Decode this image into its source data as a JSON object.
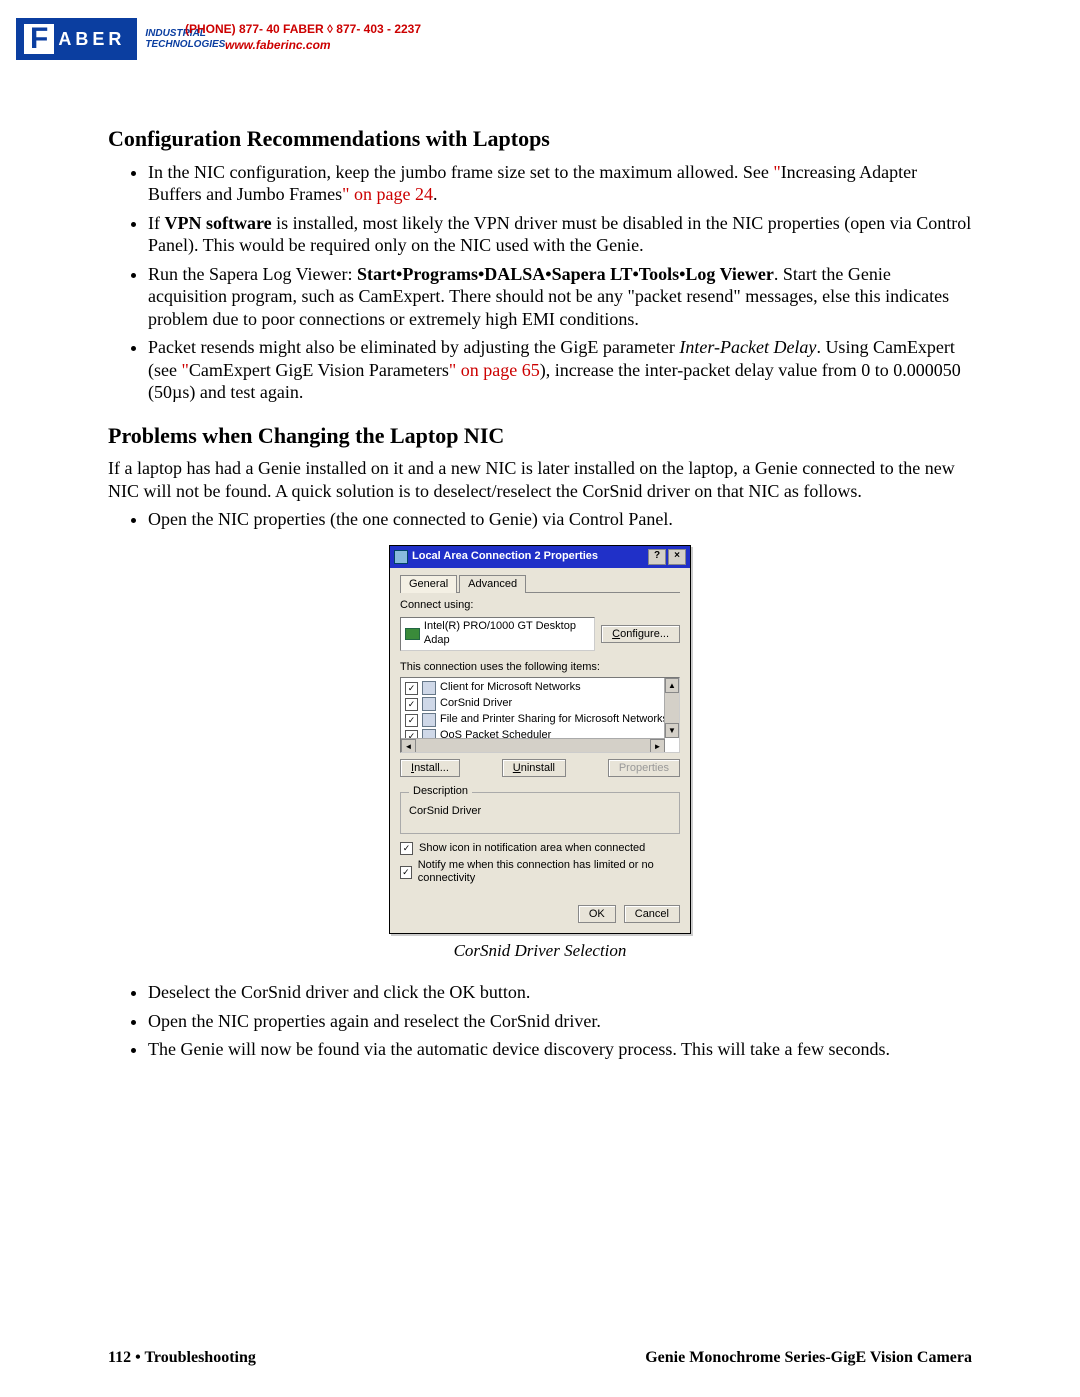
{
  "header": {
    "logo_text": "ABER",
    "tagline1": "INDUSTRIAL",
    "tagline2": "TECHNOLOGIES",
    "phone": "(PHONE) 877- 40 FABER  ◊  877- 403 - 2237",
    "url": "www.faberinc.com"
  },
  "section1": {
    "heading": "Configuration Recommendations with Laptops",
    "bullets": [
      {
        "pre": "In the NIC configuration, keep the jumbo frame size set to the maximum allowed. See ",
        "quote_open": "\"",
        "link_text": "Increasing Adapter Buffers and Jumbo Frames",
        "quote_close": "\"",
        "page_ref": " on page 24",
        "post": "."
      },
      {
        "pre": "If ",
        "bold": "VPN software",
        "post": " is installed, most likely the VPN driver must be disabled in the NIC properties (open via Control Panel). This would be required only on the NIC used with the Genie."
      },
      {
        "pre": "Run the Sapera Log Viewer: ",
        "bold": "Start•Programs•DALSA•Sapera LT•Tools•Log Viewer",
        "post": ". Start the Genie acquisition program, such as CamExpert. There should not be any \"packet resend\" messages, else this indicates problem due to poor connections or extremely high EMI conditions."
      },
      {
        "pre": "Packet resends might also be eliminated by adjusting the GigE parameter ",
        "italic": "Inter-Packet Delay",
        "mid": ". Using CamExpert (see ",
        "quote_open": "\"",
        "link_text": "CamExpert GigE Vision Parameters",
        "quote_close": "\"",
        "page_ref": " on page 65",
        "post2": "), increase the inter-packet delay value from 0 to 0.000050 (50µs) and test again."
      }
    ]
  },
  "section2": {
    "heading": "Problems when Changing the Laptop NIC",
    "intro": "If a laptop has had a Genie installed on it and a new NIC is later installed on the laptop, a Genie connected to the new NIC will not be found. A quick solution is to deselect/reselect the CorSnid driver on that NIC as follows.",
    "step1": "Open the NIC properties (the one connected to Genie) via Control Panel.",
    "caption": "CorSnid Driver Selection",
    "steps_after": [
      "Deselect the CorSnid driver and click the OK button.",
      "Open the NIC properties again and reselect the CorSnid driver.",
      "The Genie will now be found via the automatic device discovery process. This will take a few seconds."
    ]
  },
  "dialog": {
    "title": "Local Area Connection 2 Properties",
    "help_btn": "?",
    "close_btn": "×",
    "tabs": {
      "general": "General",
      "advanced": "Advanced"
    },
    "connect_using_label": "Connect using:",
    "adapter": "Intel(R) PRO/1000 GT Desktop Adap",
    "configure_btn": "Configure...",
    "items_label": "This connection uses the following items:",
    "items": [
      "Client for Microsoft Networks",
      "CorSnid Driver",
      "File and Printer Sharing for Microsoft Networks",
      "QoS Packet Scheduler"
    ],
    "install_btn": "Install...",
    "uninstall_btn": "Uninstall",
    "properties_btn": "Properties",
    "description_legend": "Description",
    "description_text": "CorSnid Driver",
    "show_icon": "Show icon in notification area when connected",
    "notify": "Notify me when this connection has limited or no connectivity",
    "ok": "OK",
    "cancel": "Cancel"
  },
  "footer": {
    "left_page": "112",
    "left_sep": "  •  ",
    "left_section": "Troubleshooting",
    "right": "Genie Monochrome Series-GigE Vision Camera"
  }
}
